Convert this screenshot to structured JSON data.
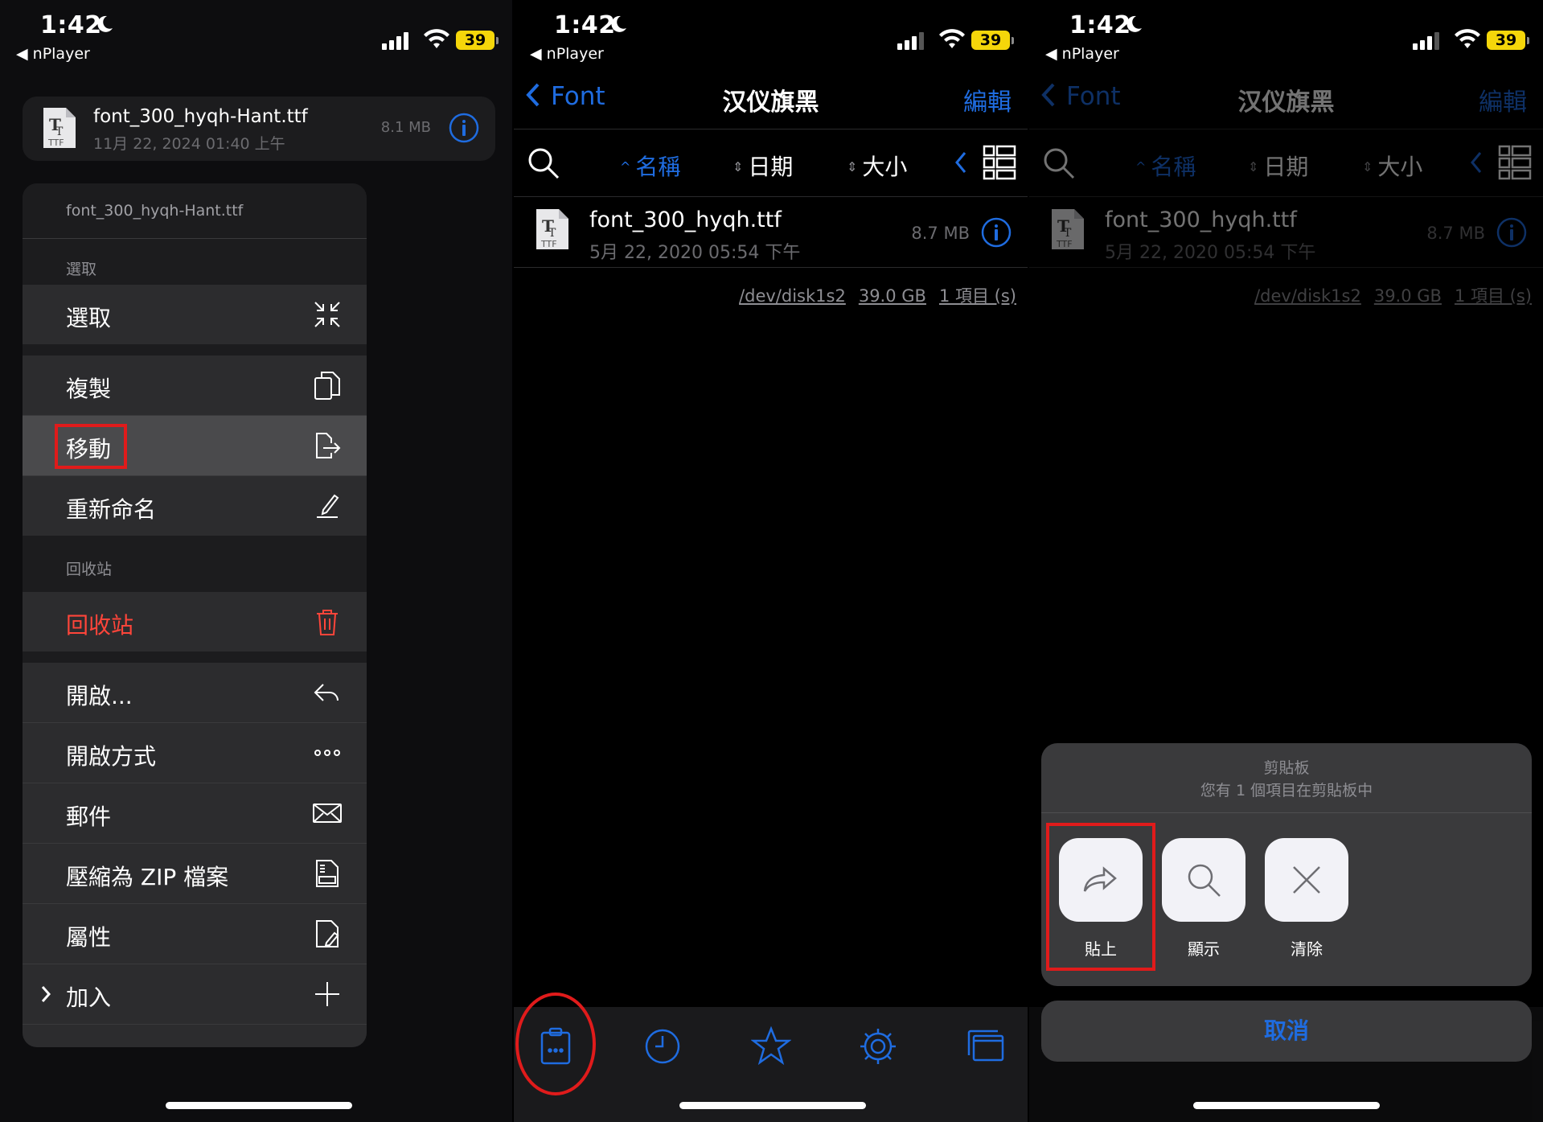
{
  "status": {
    "time": "1:42",
    "back_app": "nPlayer",
    "battery": "39"
  },
  "panel1": {
    "file": {
      "name": "font_300_hyqh-Hant.ttf",
      "date": "11月 22, 2024 01:40 上午",
      "size": "8.1 MB",
      "icon_text": "TTF"
    },
    "menu": {
      "title": "font_300_hyqh-Hant.ttf",
      "section_select": "選取",
      "item_select": "選取",
      "item_copy": "複製",
      "item_move": "移動",
      "item_rename": "重新命名",
      "section_trash": "回收站",
      "item_trash": "回收站",
      "item_open": "開啟...",
      "item_open_with": "開啟方式",
      "item_mail": "郵件",
      "item_zip": "壓縮為 ZIP 檔案",
      "item_props": "屬性",
      "item_add": "加入"
    }
  },
  "browser": {
    "back_label": "Font",
    "title": "汉仪旗黑",
    "edit_label": "編輯",
    "sort_name": "名稱",
    "sort_date": "日期",
    "sort_size": "大小",
    "file": {
      "name": "font_300_hyqh.ttf",
      "date": "5月 22, 2020 05:54 下午",
      "size": "8.7 MB",
      "icon_text": "TTF"
    },
    "footer": {
      "device": "/dev/disk1s2",
      "free": "39.0 GB",
      "count": "1 項目 (s)"
    }
  },
  "clipboard": {
    "title": "剪貼板",
    "subtitle": "您有 1 個項目在剪貼板中",
    "paste": "貼上",
    "show": "顯示",
    "clear": "清除",
    "cancel": "取消"
  },
  "colors": {
    "accent": "#1f6ce0",
    "danger": "#ff453a",
    "highlight_box": "#e01b1b",
    "battery": "#f5d60a"
  },
  "icons": [
    "moon-icon",
    "signal-icon",
    "wifi-icon",
    "ttf-file-icon",
    "info-icon",
    "select-icon",
    "copy-icon",
    "move-icon",
    "rename-icon",
    "trash-icon",
    "open-icon",
    "more-icon",
    "mail-icon",
    "zip-icon",
    "properties-icon",
    "plus-icon",
    "chevron-right-icon",
    "chevron-left-icon",
    "search-icon",
    "grid-view-icon",
    "clipboard-icon",
    "clock-icon",
    "star-icon",
    "gear-icon",
    "windows-icon",
    "share-forward-icon",
    "close-icon"
  ]
}
